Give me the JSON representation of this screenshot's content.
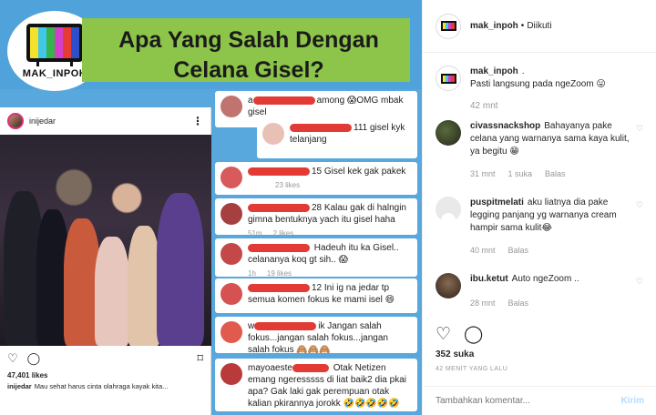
{
  "image": {
    "brand_logo": "MAK_INPOH",
    "headline": "Apa Yang Salah Dengan Celana Gisel?",
    "ig_card": {
      "username": "inijedar",
      "likes": "47,401 likes",
      "caption_user": "inijedar",
      "caption_text": "Mau sehat harus cinta olahraga kayak kita..."
    },
    "screenshot_comments": [
      {
        "user_partial": "a",
        "user_end": "among",
        "text": "😱OMG mbak gisel"
      },
      {
        "user_end": "111",
        "text": "gisel kyk telanjang"
      },
      {
        "user_end": "15",
        "text": "Gisel kek gak pakek",
        "likes": "23 likes"
      },
      {
        "user_end": "28",
        "text": "Kalau gak di halngin gimna bentuknya yach itu gisel haha",
        "time": "51m",
        "likes": "2 likes"
      },
      {
        "text": "Hadeuh itu ka Gisel.. celananya koq gt sih.. 😱",
        "time": "1h",
        "likes": "19 likes"
      },
      {
        "user_end": "12",
        "text": "Ini ig na jedar tp semua komen fokus ke mami isel 😄"
      },
      {
        "user_partial": "w",
        "user_end": "ik",
        "text": "Jangan salah fokus...jangan salah fokus...jangan salah fokus 🙈🙈🙈"
      },
      {
        "user_partial": "mayoaeste",
        "text": "Otak Netizen emang ngeresssss di liat baik2 dia pkai apa? Gak laki gak perempuan otak kalian pkirannya jorokk 🤣🤣🤣🤣🤣"
      }
    ]
  },
  "sidebar": {
    "account": "mak_inpoh",
    "dot": "•",
    "follow_status": "Diikuti",
    "caption": {
      "user": "mak_inpoh",
      "suffix": ".",
      "text": "Pasti langsung pada ngeZoom 😛",
      "time": "42 mnt"
    },
    "comments": [
      {
        "user": "civassnackshop",
        "text": "Bahayanya pake celana yang warnanya sama kaya kulit, ya begitu 😁",
        "time": "31 mnt",
        "likes": "1 suka",
        "reply": "Balas"
      },
      {
        "user": "puspitmelati",
        "text": "aku liatnya dia pake legging panjang yg warnanya cream hampir sama kulit😂",
        "time": "40 mnt",
        "reply": "Balas"
      },
      {
        "user": "ibu.ketut",
        "text": "Auto ngeZoom ..",
        "time": "28 mnt",
        "reply": "Balas"
      }
    ],
    "likes": "352 suka",
    "posted_ago": "42 MENIT YANG LALU",
    "input_placeholder": "Tambahkan komentar...",
    "send_label": "Kirim"
  },
  "colors": {
    "sky": "#58a8dd",
    "green_box": "#8dc54a",
    "redact": "#e23b35",
    "link": "#b3dbff"
  },
  "icons": [
    "heart-icon",
    "comment-icon",
    "share-icon",
    "bookmark-icon",
    "more-icon"
  ]
}
